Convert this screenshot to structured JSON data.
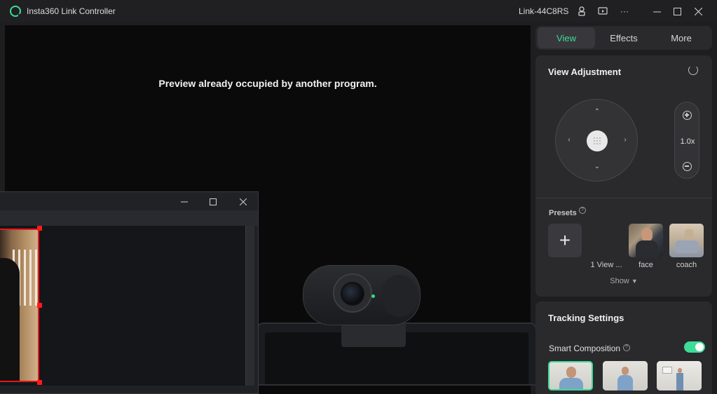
{
  "titlebar": {
    "app_title": "Insta360 Link Controller",
    "device_name": "Link-44C8RS",
    "icons": [
      "camera-device-icon",
      "screen-share-icon",
      "more-dots-icon"
    ],
    "window_controls": [
      "minimize-icon",
      "maximize-icon",
      "close-icon"
    ]
  },
  "preview": {
    "message": "Preview already occupied by another program."
  },
  "overlay_window": {
    "window_controls": [
      "minimize-icon",
      "maximize-icon",
      "close-icon"
    ]
  },
  "tabs": [
    {
      "label": "View",
      "active": true
    },
    {
      "label": "Effects",
      "active": false
    },
    {
      "label": "More",
      "active": false
    }
  ],
  "view_adjustment": {
    "title": "View Adjustment",
    "zoom_value": "1.0x",
    "presets_label": "Presets",
    "presets": [
      {
        "label": "1 View ..."
      },
      {
        "label": "face"
      },
      {
        "label": "coach"
      }
    ],
    "show_label": "Show"
  },
  "tracking": {
    "title": "Tracking Settings",
    "smart_composition_label": "Smart Composition",
    "smart_composition_enabled": true
  },
  "colors": {
    "accent": "#3ddc97",
    "handle": "#ff1a1a"
  }
}
